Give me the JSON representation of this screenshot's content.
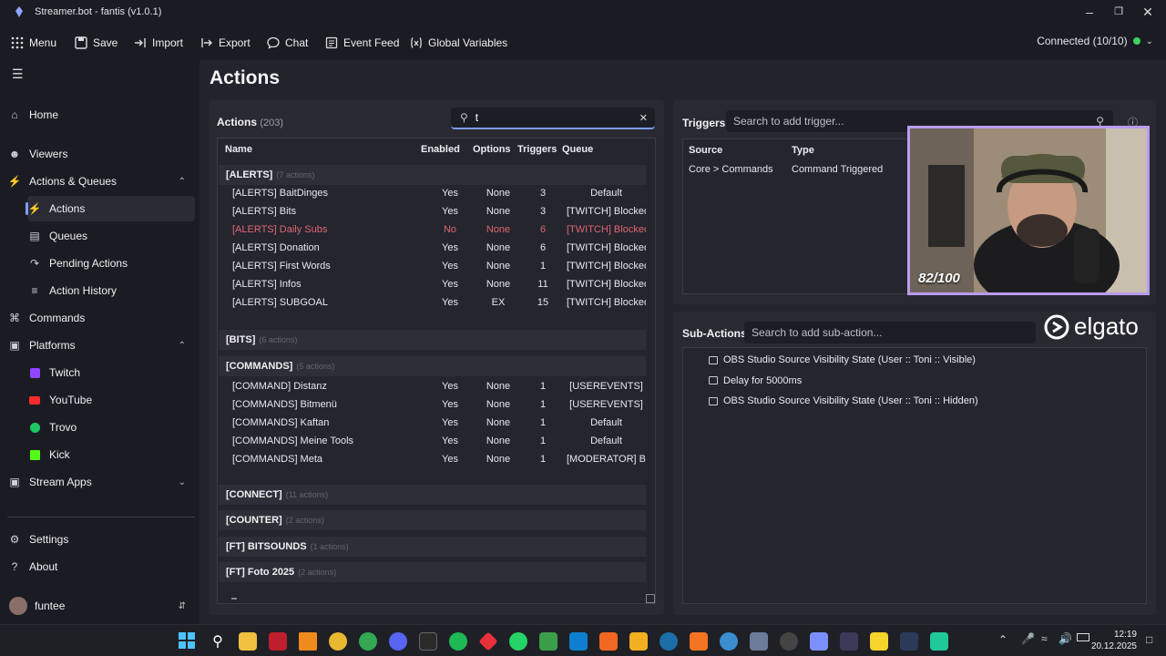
{
  "window": {
    "title": "Streamer.bot - fantis (v1.0.1)"
  },
  "menubar": {
    "items": [
      "Menu",
      "Save",
      "Import",
      "Export",
      "Chat",
      "Event Feed",
      "Global Variables"
    ],
    "status": "Connected (10/10)"
  },
  "sidebar": {
    "items": {
      "home": "Home",
      "viewers": "Viewers",
      "actions_queues": "Actions & Queues",
      "actions": "Actions",
      "queues": "Queues",
      "pending": "Pending Actions",
      "history": "Action History",
      "commands": "Commands",
      "platforms": "Platforms",
      "twitch": "Twitch",
      "youtube": "YouTube",
      "trovo": "Trovo",
      "kick": "Kick",
      "stream_apps": "Stream Apps",
      "settings": "Settings",
      "about": "About"
    },
    "user": "funtee"
  },
  "page": {
    "title": "Actions"
  },
  "actions_panel": {
    "title": "Actions",
    "count": "(203)",
    "search_value": "t",
    "columns": {
      "name": "Name",
      "enabled": "Enabled",
      "options": "Options",
      "triggers": "Triggers",
      "queue": "Queue"
    },
    "groups": {
      "alerts": {
        "name": "[ALERTS]",
        "count": "(7 actions)"
      },
      "bits": {
        "name": "[BITS]",
        "count": "(6 actions)"
      },
      "commands": {
        "name": "[COMMANDS]",
        "count": "(5 actions)"
      },
      "connect": {
        "name": "[CONNECT]",
        "count": "(11 actions)"
      },
      "counter": {
        "name": "[COUNTER]",
        "count": "(2 actions)"
      },
      "ftbits": {
        "name": "[FT] BITSOUNDS",
        "count": "(1 actions)"
      },
      "ftfoto": {
        "name": "[FT] Foto 2025",
        "count": "(2 actions)"
      }
    },
    "alerts_rows": [
      {
        "name": "[ALERTS] BaitDinges",
        "enabled": "Yes",
        "options": "None",
        "triggers": "3",
        "queue": "Default"
      },
      {
        "name": "[ALERTS] Bits",
        "enabled": "Yes",
        "options": "None",
        "triggers": "3",
        "queue": "[TWITCH] Blocked"
      },
      {
        "name": "[ALERTS] Daily Subs",
        "enabled": "No",
        "options": "None",
        "triggers": "6",
        "queue": "[TWITCH] Blocked"
      },
      {
        "name": "[ALERTS] Donation",
        "enabled": "Yes",
        "options": "None",
        "triggers": "6",
        "queue": "[TWITCH] Blocked"
      },
      {
        "name": "[ALERTS] First Words",
        "enabled": "Yes",
        "options": "None",
        "triggers": "1",
        "queue": "[TWITCH] Blocked"
      },
      {
        "name": "[ALERTS] Infos",
        "enabled": "Yes",
        "options": "None",
        "triggers": "11",
        "queue": "[TWITCH] Blocked"
      },
      {
        "name": "[ALERTS] SUBGOAL",
        "enabled": "Yes",
        "options": "EX",
        "triggers": "15",
        "queue": "[TWITCH] Blocked"
      }
    ],
    "command_rows": [
      {
        "name": "[COMMAND] Distanz",
        "enabled": "Yes",
        "options": "None",
        "triggers": "1",
        "queue": "[USEREVENTS]"
      },
      {
        "name": "[COMMANDS] Bitmenü",
        "enabled": "Yes",
        "options": "None",
        "triggers": "1",
        "queue": "[USEREVENTS]"
      },
      {
        "name": "[COMMANDS] Kaftan",
        "enabled": "Yes",
        "options": "None",
        "triggers": "1",
        "queue": "Default"
      },
      {
        "name": "[COMMANDS] Meine Tools",
        "enabled": "Yes",
        "options": "None",
        "triggers": "1",
        "queue": "Default"
      },
      {
        "name": "[COMMANDS] Meta",
        "enabled": "Yes",
        "options": "None",
        "triggers": "1",
        "queue": "[MODERATOR] B"
      }
    ]
  },
  "triggers_panel": {
    "title": "Triggers",
    "search_placeholder": "Search to add trigger...",
    "columns": {
      "source": "Source",
      "type": "Type"
    },
    "row": {
      "source": "Core > Commands",
      "type": "Command Triggered"
    }
  },
  "subactions_panel": {
    "title": "Sub-Actions",
    "search_placeholder": "Search to add sub-action...",
    "items": [
      "OBS Studio Source Visibility State (User :: Toni :: Visible)",
      "Delay for 5000ms",
      "OBS Studio Source Visibility State (User :: Toni :: Hidden)"
    ]
  },
  "overlay": {
    "counter": "82/100",
    "brand": "elgato"
  },
  "taskbar": {
    "time": "12:19",
    "date": "20.12.2025"
  },
  "colors": {
    "accent": "#7a9cff",
    "disabled": "#e06673",
    "connected": "#3fd15e",
    "cam_border": "#b99cf0"
  }
}
